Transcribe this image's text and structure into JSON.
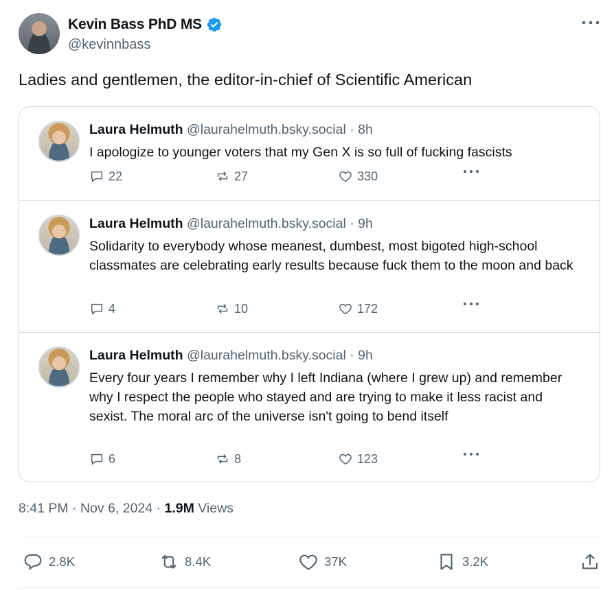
{
  "author": {
    "name": "Kevin Bass PhD MS",
    "handle": "@kevinnbass",
    "verified_color": "#1d9bf0"
  },
  "tweet": {
    "text": "Ladies and gentlemen, the editor-in-chief of Scientific American",
    "time": "8:41 PM",
    "date": "Nov 6, 2024",
    "views": "1.9M",
    "views_label": "Views"
  },
  "quoted_posts": [
    {
      "name": "Laura Helmuth",
      "handle": "@laurahelmuth.bsky.social",
      "age": "8h",
      "text": "I apologize to younger voters that my Gen X is so full of fucking fascists",
      "replies": "22",
      "reposts": "27",
      "likes": "330"
    },
    {
      "name": "Laura Helmuth",
      "handle": "@laurahelmuth.bsky.social",
      "age": "9h",
      "text": "Solidarity to everybody whose meanest, dumbest, most bigoted high-school classmates are celebrating early results because fuck them to the moon and back",
      "replies": "4",
      "reposts": "10",
      "likes": "172"
    },
    {
      "name": "Laura Helmuth",
      "handle": "@laurahelmuth.bsky.social",
      "age": "9h",
      "text": "Every four years I remember why I left Indiana (where I grew up) and remember why I respect the people who stayed and are trying to make it less racist and sexist. The moral arc of the universe isn't going to bend itself",
      "replies": "6",
      "reposts": "8",
      "likes": "123"
    }
  ],
  "stats": {
    "replies": "2.8K",
    "reposts": "8.4K",
    "likes": "37K",
    "bookmarks": "3.2K"
  },
  "icons": [
    "verified-badge-icon",
    "more-icon",
    "reply-icon",
    "repost-icon",
    "like-icon",
    "bookmark-icon",
    "share-icon"
  ]
}
